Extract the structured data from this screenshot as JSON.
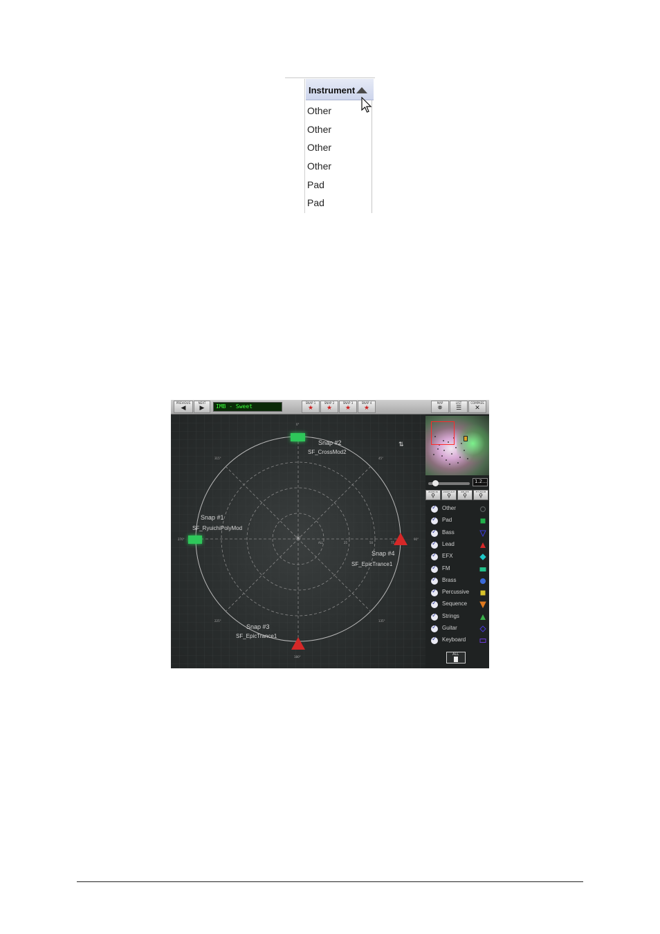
{
  "column_crop": {
    "header": "Instrument",
    "sort_icon": "sort-ascending-icon",
    "rows": [
      "Other",
      "Other",
      "Other",
      "Other",
      "Pad",
      "Pad"
    ]
  },
  "app": {
    "toolbar": {
      "previous": "PREVIOUS",
      "next": "NEXT",
      "lcd_text": "IMB - Sweet",
      "snaps": [
        "SNAP 1",
        "SNAP 2",
        "SNAP 3",
        "SNAP 4"
      ],
      "map": "MAP",
      "list": "LIST",
      "compass": "COMPASS"
    },
    "map": {
      "degrees": {
        "d0": "0°",
        "d45": "45°",
        "d90": "90°",
        "d135": "135°",
        "d180": "180°",
        "d225": "225°",
        "d270": "270°",
        "d315": "315°"
      },
      "ring_labels": [
        "ALL",
        "25",
        "50",
        "75"
      ],
      "snaps": [
        {
          "title": "Snap #1",
          "patch": "SF_RyuichiPolyMod"
        },
        {
          "title": "Snap #2",
          "patch": "SF_CrossMod2"
        },
        {
          "title": "Snap #3",
          "patch": "SF_EpicTrance1"
        },
        {
          "title": "Snap #4",
          "patch": "SF_EpicTrance1"
        }
      ]
    },
    "sidebar": {
      "zoom_value": "1.2...",
      "zoom_buttons": [
        "ZOOM IN",
        "ZOOM OUT",
        "RELATE",
        "FIT ZOOM"
      ],
      "instruments": [
        {
          "name": "Other",
          "shape": "circle",
          "color": "#3a3f3f"
        },
        {
          "name": "Pad",
          "shape": "square",
          "color": "#22b04a"
        },
        {
          "name": "Bass",
          "shape": "triangle-down",
          "color": "#3a3ad8"
        },
        {
          "name": "Lead",
          "shape": "triangle-up",
          "color": "#d62828"
        },
        {
          "name": "EFX",
          "shape": "diamond",
          "color": "#1fc7c7"
        },
        {
          "name": "FM",
          "shape": "rect",
          "color": "#22c08a"
        },
        {
          "name": "Brass",
          "shape": "circle",
          "color": "#3a6ad8"
        },
        {
          "name": "Percussive",
          "shape": "square",
          "color": "#d8c22a"
        },
        {
          "name": "Sequence",
          "shape": "triangle-down",
          "color": "#e07a1f"
        },
        {
          "name": "Strings",
          "shape": "triangle-up",
          "color": "#3ab04a"
        },
        {
          "name": "Guitar",
          "shape": "diamond",
          "color": "#4a3ad8"
        },
        {
          "name": "Keyboard",
          "shape": "rect",
          "color": "#6a3ad8"
        }
      ],
      "all_button": "ALL"
    }
  }
}
